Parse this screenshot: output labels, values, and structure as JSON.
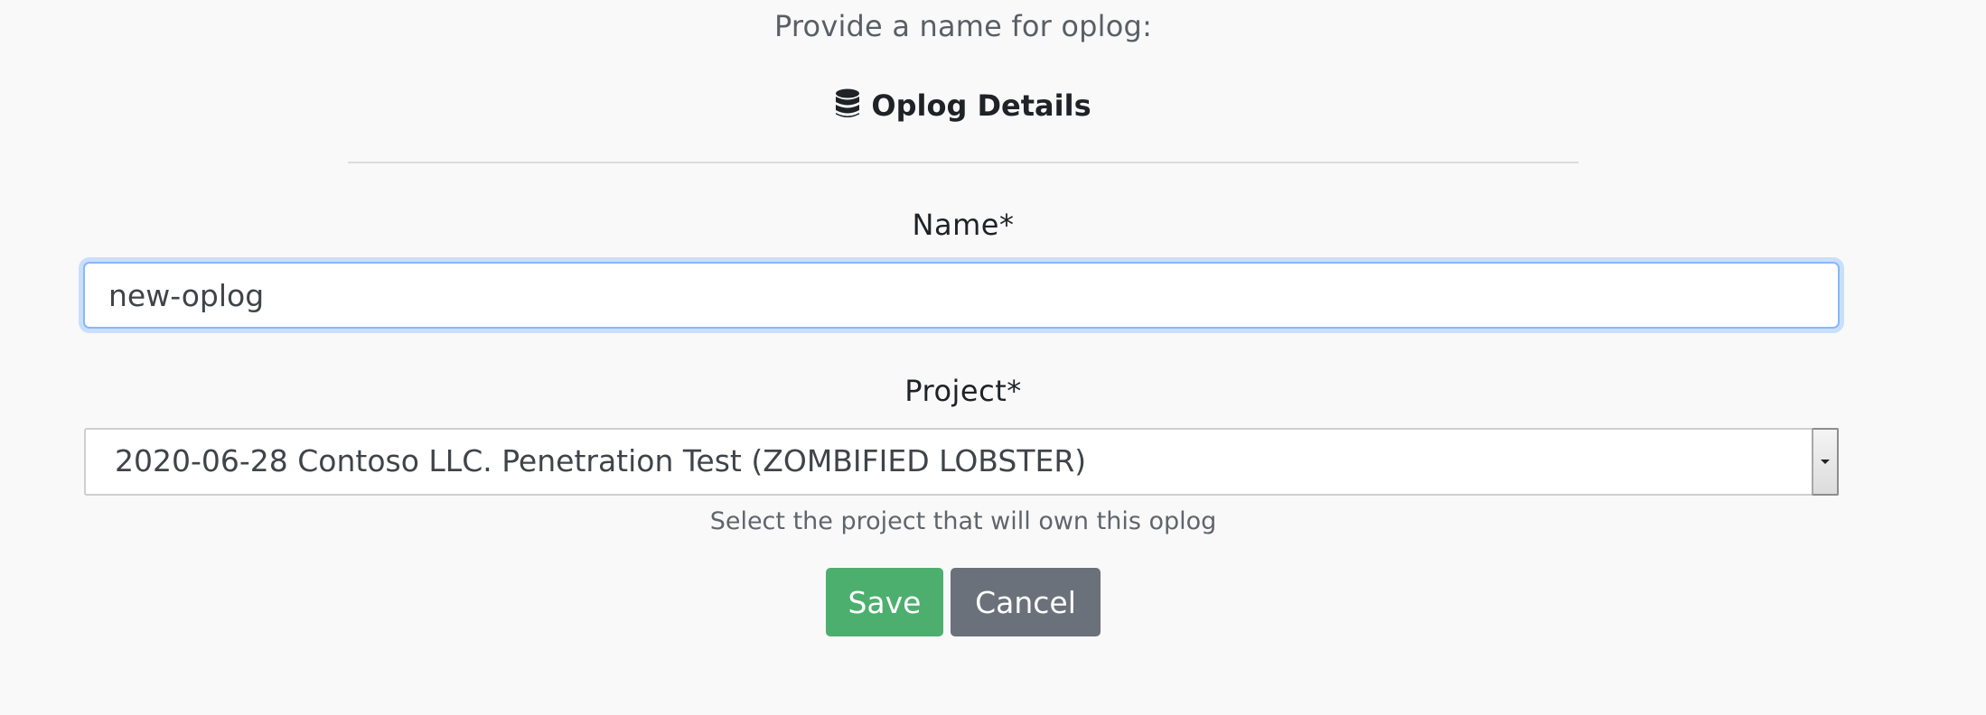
{
  "form": {
    "instructions": "Provide a name for oplog:",
    "section_title": "Oplog Details",
    "section_icon": "database-icon",
    "name": {
      "label": "Name*",
      "value": "new-oplog"
    },
    "project": {
      "label": "Project*",
      "selected": "2020-06-28 Contoso LLC. Penetration Test (ZOMBIFIED LOBSTER)",
      "help_text": "Select the project that will own this oplog"
    },
    "save_label": "Save",
    "cancel_label": "Cancel"
  },
  "colors": {
    "save": "#4caf6e",
    "cancel": "#6b717a",
    "focus_border": "#86b7fe"
  }
}
